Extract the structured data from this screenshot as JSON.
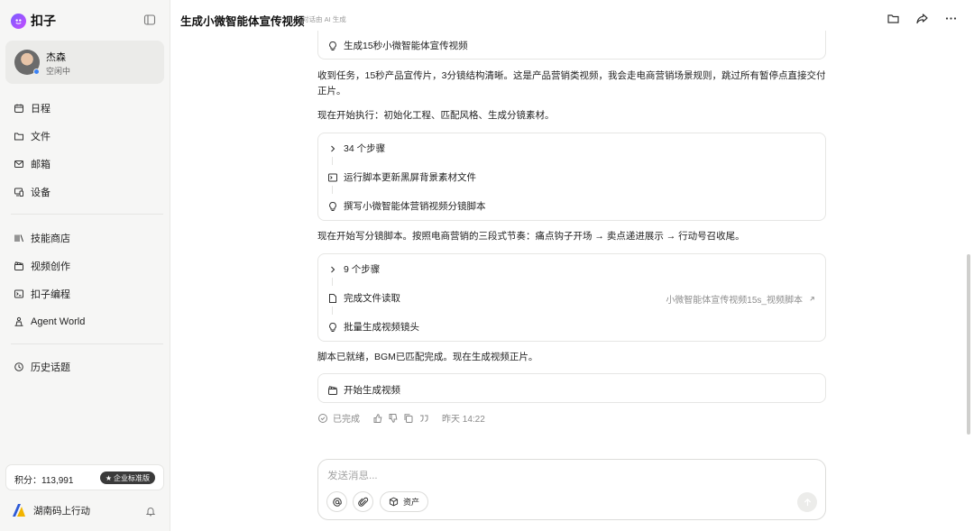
{
  "sidebar": {
    "brand": "扣子",
    "profile": {
      "name": "杰森",
      "status": "空闲中"
    },
    "nav_primary": [
      {
        "label": "日程",
        "icon": "calendar-icon"
      },
      {
        "label": "文件",
        "icon": "folder-icon"
      },
      {
        "label": "邮箱",
        "icon": "mail-icon"
      },
      {
        "label": "设备",
        "icon": "device-icon"
      }
    ],
    "nav_secondary": [
      {
        "label": "技能商店",
        "icon": "skill-store-icon"
      },
      {
        "label": "视频创作",
        "icon": "clapperboard-icon"
      },
      {
        "label": "扣子编程",
        "icon": "terminal-icon"
      },
      {
        "label": "Agent World",
        "icon": "agent-world-icon"
      }
    ],
    "history": {
      "label": "历史话题",
      "icon": "history-icon"
    },
    "points_label": "积分：113,991",
    "plan_badge": "企业标准版",
    "org_name": "湖南码上行动"
  },
  "header": {
    "title": "生成小微智能体宣传视频",
    "subtitle": "对话由 AI 生成"
  },
  "chat": {
    "top_card_label": "生成15秒小微智能体宣传视频",
    "para1": "收到任务，15秒产品宣传片，3分镜结构清晰。这是产品营销类视频，我会走电商营销场景规则，跳过所有暂停点直接交付正片。",
    "para2": "现在开始执行：初始化工程、匹配风格、生成分镜素材。",
    "card1": {
      "steps": "34 个步骤",
      "item1": "运行脚本更新黑屏背景素材文件",
      "item2": "撰写小微智能体营销视频分镜脚本"
    },
    "para3": "现在开始写分镜脚本。按照电商营销的三段式节奏：痛点钩子开场 → 卖点递进展示 → 行动号召收尾。",
    "card2": {
      "steps": "9 个步骤",
      "item1": "完成文件读取",
      "item1_link": "小微智能体宣传视频15s_视频脚本",
      "item2": "批量生成视频镜头"
    },
    "para4": "脚本已就绪，BGM已匹配完成。现在生成视频正片。",
    "card3_label": "开始生成视频",
    "status": "已完成",
    "timestamp": "昨天 14:22"
  },
  "composer": {
    "placeholder": "发送消息...",
    "assets_label": "资产"
  },
  "colors": {
    "brand": "#7a5cff",
    "status_blue": "#3b82f6",
    "badge_bg": "#3a3a3a"
  }
}
